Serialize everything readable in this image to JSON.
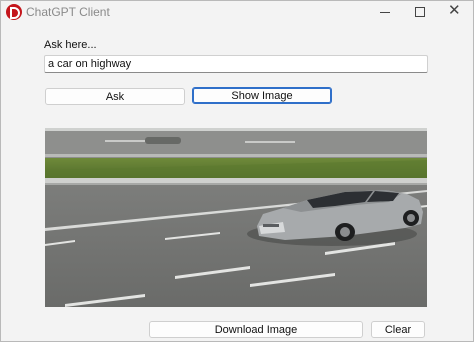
{
  "window": {
    "title": "ChatGPT Client"
  },
  "form": {
    "ask_label": "Ask here...",
    "query_value": "a car on highway"
  },
  "buttons": {
    "ask": "Ask",
    "show_image": "Show Image",
    "download_image": "Download Image",
    "clear": "Clear"
  },
  "colors": {
    "app_icon": "#c4161c",
    "focus_border": "#2f6fc9"
  }
}
